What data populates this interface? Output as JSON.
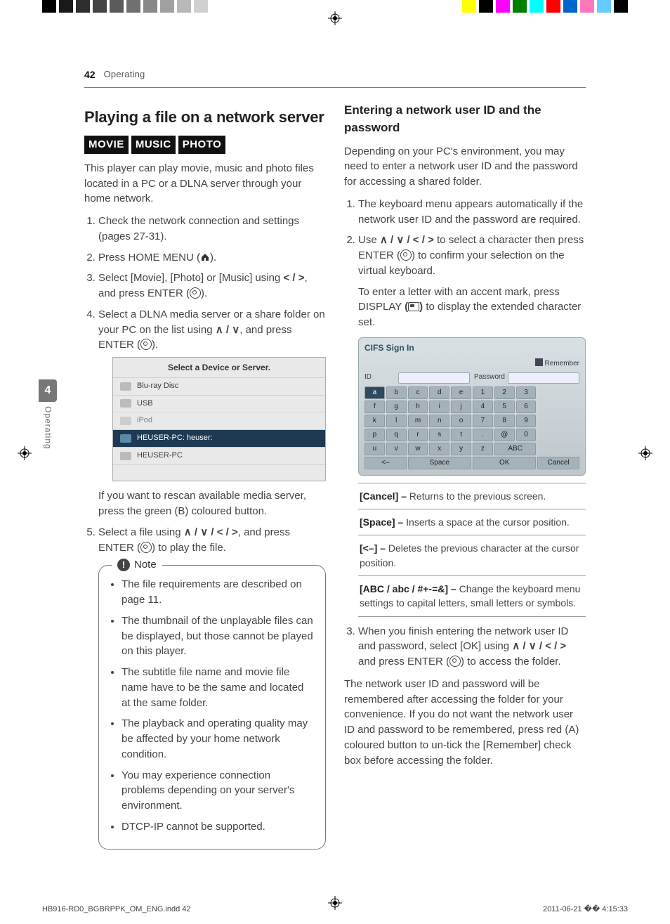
{
  "page_number": "42",
  "section_name": "Operating",
  "spine": {
    "number": "4",
    "label": "Operating"
  },
  "left": {
    "h1": "Playing a file on a network server",
    "badges": [
      "MOVIE",
      "MUSIC",
      "PHOTO"
    ],
    "intro": "This player can play movie, music and photo files located in a PC or a DLNA server through your home network.",
    "steps": [
      "Check the network connection and settings (pages 27-31).",
      "Press HOME MENU ( ).",
      "Select [Movie], [Photo] or [Music] using < / >, and press ENTER ( ).",
      "Select a DLNA media server or a share folder on your PC on the list using ∧ / ∨, and press ENTER ( )."
    ],
    "device_list_title": "Select a Device or Server.",
    "device_items": [
      "Blu-ray Disc",
      "USB",
      "iPod",
      "HEUSER-PC: heuser:",
      "HEUSER-PC"
    ],
    "rescan_hint": "If you want to rescan available media server, press the green (B) coloured button.",
    "step5": "Select a file using ∧ / ∨ / < / >, and press ENTER ( ) to play the file.",
    "note_label": "Note",
    "notes": [
      "The file requirements are described on page 11.",
      "The thumbnail of the unplayable files can be displayed, but those cannot be played on this player.",
      "The subtitle file name and movie file name have to be the same and located at the same folder.",
      "The playback and operating quality may be affected by your home network condition.",
      "You may experience connection problems depending on your server's environment.",
      "DTCP-IP cannot be supported."
    ]
  },
  "right": {
    "h2": "Entering a network user ID and the password",
    "intro": "Depending on your PC's environment, you may need to enter a network user ID and the password for accessing a shared folder.",
    "step1": "The keyboard menu appears automatically if the network user ID and the password are required.",
    "step2": "Use ∧ / ∨ / < / > to select a character then press ENTER ( ) to confirm your selection on the virtual keyboard.",
    "step2b": "To enter a letter with an accent mark, press DISPLAY ( ) to display the extended character set.",
    "cifs": {
      "title": "CIFS Sign In",
      "id_label": "ID",
      "pw_label": "Password",
      "remember": "Remember",
      "keys_rows": [
        [
          "a",
          "b",
          "c",
          "d",
          "e",
          "1",
          "2",
          "3"
        ],
        [
          "f",
          "g",
          "h",
          "i",
          "j",
          "4",
          "5",
          "6"
        ],
        [
          "k",
          "l",
          "m",
          "n",
          "o",
          "7",
          "8",
          "9"
        ],
        [
          "p",
          "q",
          "r",
          "s",
          "t",
          ".",
          "@",
          "0"
        ],
        [
          "u",
          "v",
          "w",
          "x",
          "y",
          "z",
          "ABC",
          ""
        ]
      ],
      "bottom": [
        "<–",
        "Space",
        "OK",
        "Cancel"
      ]
    },
    "defs": [
      {
        "k": "[Cancel] –",
        "v": " Returns to the previous screen."
      },
      {
        "k": "[Space] –",
        "v": " Inserts a space at the cursor position."
      },
      {
        "k": "[<–] –",
        "v": " Deletes the previous character at the cursor position."
      },
      {
        "k": "[ABC / abc / #+-=&] –",
        "v": " Change the keyboard menu settings to capital letters, small letters or symbols."
      }
    ],
    "step3": "When you finish entering the network user ID and password, select [OK] using ∧ / ∨ / < / > and press ENTER ( ) to access the folder.",
    "outro": "The network user ID and password will be remembered after accessing the folder for your convenience. If you do not want the network user ID and password to be remembered, press red (A) coloured button to un-tick the [Remember] check box before accessing the folder."
  },
  "footer": {
    "file": "HB916-RD0_BGBRPPK_OM_ENG.indd   42",
    "date": "2011-06-21   �� 4:15:33"
  }
}
